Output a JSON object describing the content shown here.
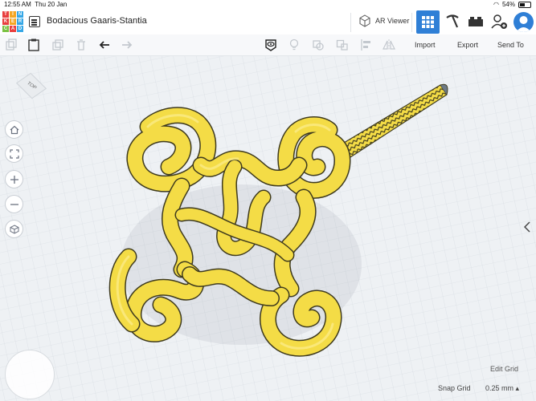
{
  "status": {
    "time": "12:55 AM",
    "date": "Thu 20 Jan",
    "battery": "54%"
  },
  "app": {
    "logo_letters": [
      "T",
      "I",
      "N",
      "K",
      "E",
      "R",
      "C",
      "A",
      "D"
    ],
    "logo_colors": [
      "#e83e3e",
      "#f5a623",
      "#35a7e6",
      "#e83e3e",
      "#f5a623",
      "#35a7e6",
      "#7ac142",
      "#e83e3e",
      "#35a7e6"
    ],
    "design_title": "Bodacious Gaaris-Stantia",
    "ar_viewer_label": "AR Viewer",
    "accent": "#2f7fd6"
  },
  "toolbar": {
    "import_label": "Import",
    "export_label": "Export",
    "send_to_label": "Send To"
  },
  "viewport": {
    "viewcube_label": "TOP",
    "edit_grid_label": "Edit Grid",
    "snap_grid_label": "Snap Grid",
    "snap_grid_value": "0.25 mm",
    "model_color": "#f4dc46",
    "model_edge_color": "#3e3a1e"
  }
}
